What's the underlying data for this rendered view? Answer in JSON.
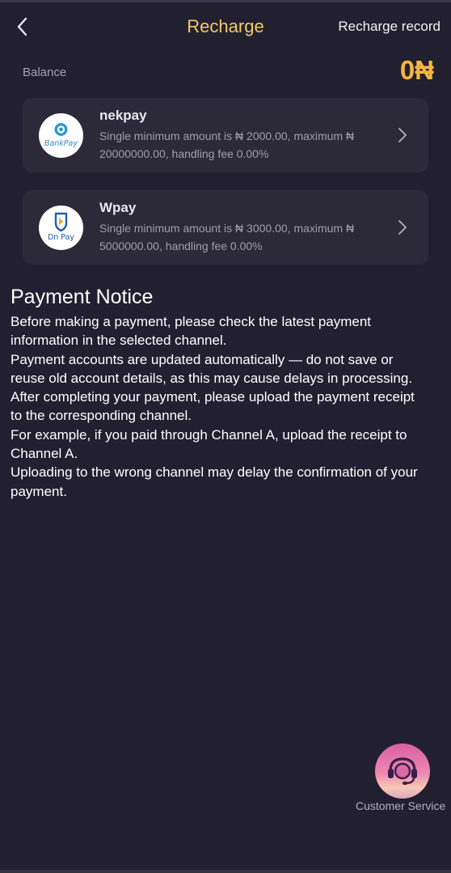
{
  "header": {
    "title": "Recharge",
    "record_label": "Recharge record"
  },
  "balance": {
    "label": "Balance",
    "value": "0₦"
  },
  "channels": [
    {
      "name": "nekpay",
      "logo_text": "BankPay",
      "desc_line1": "Single minimum amount is ₦ 2000.00, maximum ₦",
      "desc_line2": "20000000.00, handling fee 0.00%"
    },
    {
      "name": "Wpay",
      "logo_text": "Dn Pay",
      "desc_line1": "Single minimum amount is ₦ 3000.00, maximum ₦",
      "desc_line2": "5000000.00, handling fee 0.00%"
    }
  ],
  "notice": {
    "title": "Payment Notice",
    "lines": [
      "Before making a payment, please check the latest payment",
      "information in the selected channel.",
      "Payment accounts are updated automatically — do not save or",
      "reuse old account details, as this may cause delays in processing.",
      "After completing your payment, please upload the payment receipt",
      "to the corresponding channel.",
      "For example, if you paid through Channel A, upload the receipt to",
      "Channel A.",
      "Uploading to the wrong channel may delay the confirmation of your",
      "payment."
    ]
  },
  "customer_service": {
    "label": "Customer Service"
  },
  "colors": {
    "background": "#222030",
    "card": "#2c2a39",
    "title_gold": "#f3c867",
    "balance_orange": "#f6b640"
  }
}
